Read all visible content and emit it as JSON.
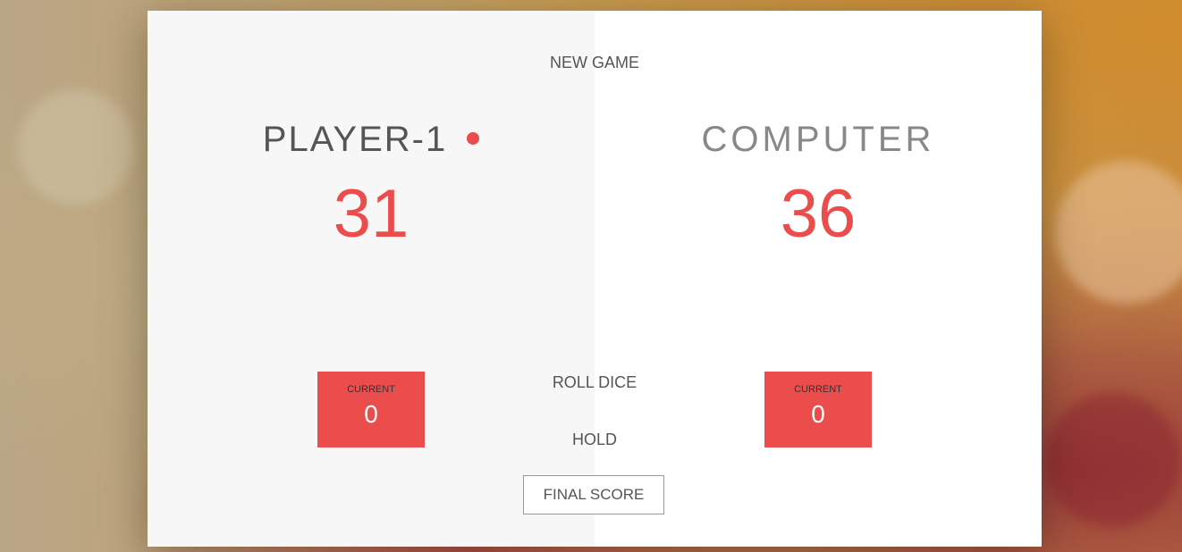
{
  "colors": {
    "accent": "#EB4D4D",
    "left_panel": "#F7F7F7",
    "right_panel": "#FFFFFF",
    "text": "#555555"
  },
  "controls": {
    "new_game": "NEW GAME",
    "roll_dice": "ROLL DICE",
    "hold": "HOLD",
    "final_score_placeholder": "FINAL SCORE"
  },
  "players": [
    {
      "name": "PLAYER-1",
      "score": "31",
      "current_label": "CURRENT",
      "current_score": "0",
      "active": true
    },
    {
      "name": "COMPUTER",
      "score": "36",
      "current_label": "CURRENT",
      "current_score": "0",
      "active": false
    }
  ]
}
